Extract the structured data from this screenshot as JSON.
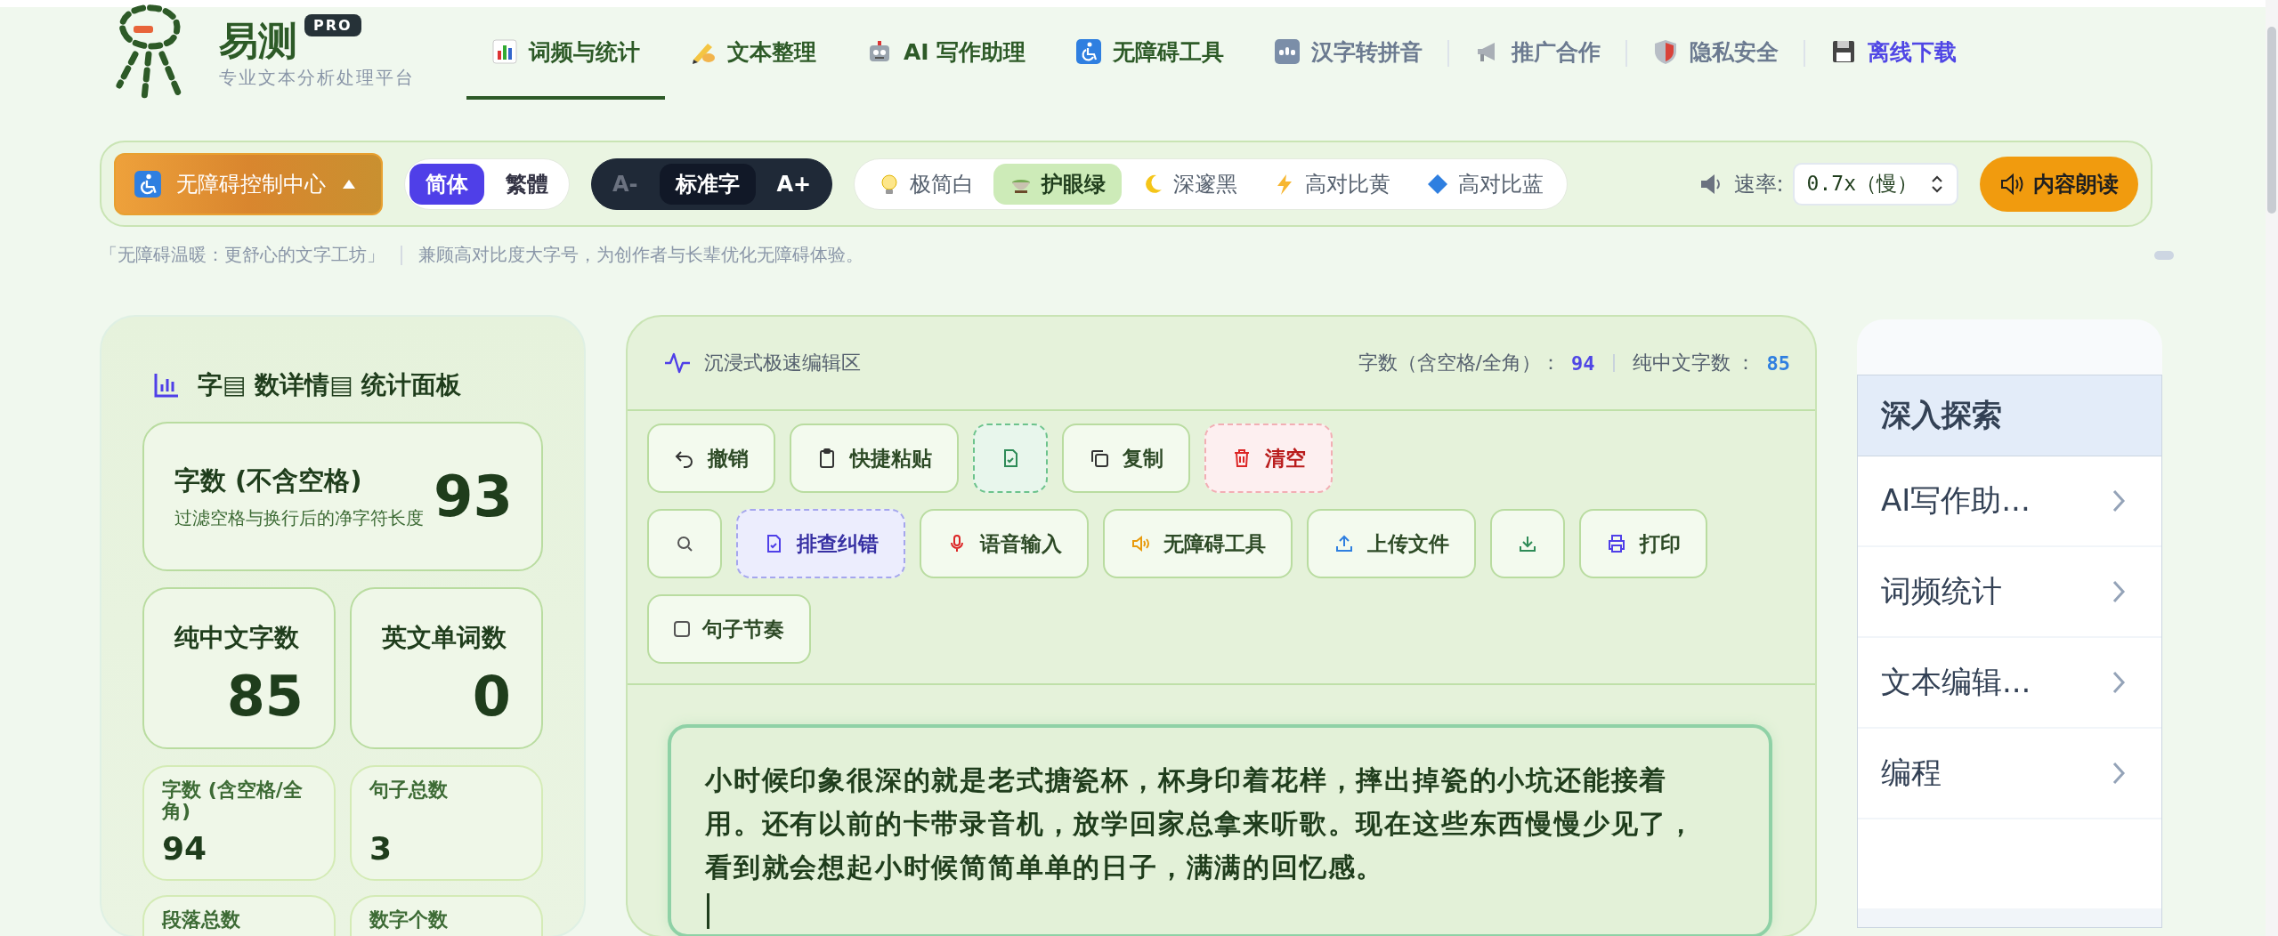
{
  "header": {
    "logo_title": "易测",
    "badge": "PRO",
    "subtitle": "专业文本分析处理平台"
  },
  "nav": [
    {
      "label": "词频与统计",
      "kind": "tool",
      "selected": true
    },
    {
      "label": "文本整理",
      "kind": "tool",
      "selected": false
    },
    {
      "label": "AI 写作助理",
      "kind": "tool",
      "selected": false
    },
    {
      "label": "无障碍工具",
      "kind": "tool",
      "selected": false
    },
    {
      "label": "汉字转拼音",
      "kind": "info",
      "selected": false
    },
    {
      "label": "推广合作",
      "kind": "info",
      "selected": false
    },
    {
      "label": "隐私安全",
      "kind": "info",
      "selected": false
    },
    {
      "label": "离线下载",
      "kind": "download",
      "selected": false
    }
  ],
  "toolbar": {
    "access_button": {
      "label": "无障碍控制中心",
      "expanded": true
    },
    "script": [
      {
        "label": "简体",
        "selected": true
      },
      {
        "label": "繁體",
        "selected": false
      }
    ],
    "font_size": [
      {
        "label": "A-",
        "selected": false,
        "disabled": true
      },
      {
        "label": "标准字",
        "selected": true,
        "disabled": false
      },
      {
        "label": "A+",
        "selected": false,
        "disabled": false
      }
    ],
    "themes": [
      {
        "label": "极简白",
        "selected": false
      },
      {
        "label": "护眼绿",
        "selected": true
      },
      {
        "label": "深邃黑",
        "selected": false
      },
      {
        "label": "高对比黄",
        "selected": false
      },
      {
        "label": "高对比蓝",
        "selected": false
      }
    ],
    "speed": {
      "label": "速率:",
      "value": "0.7x（慢）"
    },
    "read_button": "内容朗读"
  },
  "caption": [
    "「无障碍温暖：更舒心的文字工坊」",
    "兼顾高对比度大字号，为创作者与长辈优化无障碍体验。"
  ],
  "stats": {
    "title": "字▤ 数详情▤ 统计面板",
    "primary": {
      "label": "字数 (不含空格)",
      "note": "过滤空格与换行后的净字符长度",
      "value": "93"
    },
    "large": [
      {
        "label": "纯中文字数",
        "value": "85"
      },
      {
        "label": "英文单词数",
        "value": "0"
      }
    ],
    "small": [
      {
        "label": "字数 (含空格/全角)",
        "value": "94"
      },
      {
        "label": "句子总数",
        "value": "3"
      },
      {
        "label": "段落总数"
      },
      {
        "label": "数字个数"
      }
    ]
  },
  "editor": {
    "title": "沉浸式极速编辑区",
    "counts": [
      {
        "label": "字数（含空格/全角）：",
        "value": "94"
      },
      {
        "label": "纯中文字数 ：",
        "value": "85"
      }
    ],
    "toolbar_rows": [
      [
        {
          "kind": "plain",
          "label": "撤销"
        },
        {
          "kind": "plain",
          "label": "快捷粘贴"
        },
        {
          "kind": "dashed-green"
        },
        {
          "kind": "plain",
          "label": "复制"
        },
        {
          "kind": "danger",
          "label": "清空"
        }
      ],
      [
        {
          "kind": "plain"
        },
        {
          "kind": "dashed-blue",
          "label": "排查纠错"
        },
        {
          "kind": "plain",
          "label": "语音输入"
        },
        {
          "kind": "plain",
          "label": "无障碍工具"
        },
        {
          "kind": "plain",
          "label": "上传文件"
        },
        {
          "kind": "plain"
        },
        {
          "kind": "plain",
          "label": "打印"
        }
      ],
      [
        {
          "kind": "checkbox",
          "label": "句子节奏",
          "checked": false
        }
      ]
    ],
    "text": "小时候印象很深的就是老式搪瓷杯，杯身印着花样，摔出掉瓷的小坑还能接着用。还有以前的卡带录音机，放学回家总拿来听歌。现在这些东西慢慢少见了，看到就会想起小时候简简单单的日子，满满的回忆感。"
  },
  "explore": {
    "title": "深入探索",
    "items": [
      "AI写作助...",
      "词频统计",
      "文本编辑...",
      "编程"
    ]
  }
}
